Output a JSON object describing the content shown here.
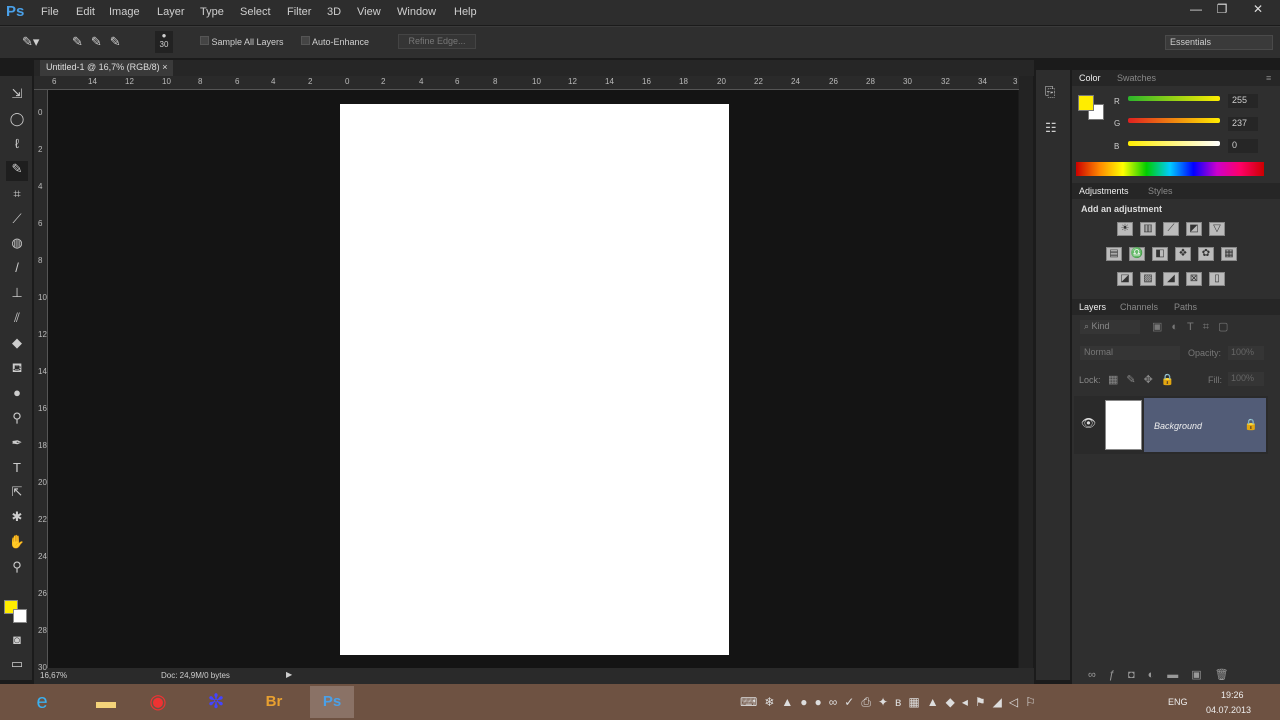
{
  "app": {
    "logo": "Ps"
  },
  "menu": [
    "File",
    "Edit",
    "Image",
    "Layer",
    "Type",
    "Select",
    "Filter",
    "3D",
    "View",
    "Window",
    "Help"
  ],
  "window_controls": {
    "minimize": "—",
    "restore": "❐",
    "close": "✕"
  },
  "options": {
    "brush_size": "30",
    "sample_all_layers": "Sample All Layers",
    "auto_enhance": "Auto-Enhance",
    "refine_edge": "Refine Edge...",
    "workspace": "Essentials"
  },
  "document_tab": {
    "title": "Untitled-1 @ 16,7% (RGB/8)",
    "close": "×"
  },
  "hruler": [
    "6",
    "14",
    "12",
    "10",
    "8",
    "6",
    "4",
    "2",
    "0",
    "2",
    "4",
    "6",
    "8",
    "10",
    "12",
    "14",
    "16",
    "18",
    "20",
    "22",
    "24",
    "26",
    "28",
    "30",
    "32",
    "34",
    "3"
  ],
  "vruler": [
    "0",
    "2",
    "4",
    "6",
    "8",
    "10",
    "12",
    "14",
    "16",
    "18",
    "20",
    "22",
    "24",
    "26",
    "28",
    "30"
  ],
  "status": {
    "zoom": "16,67%",
    "doc": "Doc: 24,9M/0 bytes"
  },
  "color_panel": {
    "tabs": [
      "Color",
      "Swatches"
    ],
    "r_label": "R",
    "g_label": "G",
    "b_label": "B",
    "r": "255",
    "g": "237",
    "b": "0",
    "foreground": "#ffed00",
    "background": "#ffffff"
  },
  "adjustments_panel": {
    "tabs": [
      "Adjustments",
      "Styles"
    ],
    "heading": "Add an adjustment"
  },
  "layers_panel": {
    "tabs": [
      "Layers",
      "Channels",
      "Paths"
    ],
    "kind": "Kind",
    "blend": "Normal",
    "opacity_label": "Opacity:",
    "opacity": "100%",
    "lock_label": "Lock:",
    "fill_label": "Fill:",
    "fill": "100%",
    "layers": [
      {
        "name": "Background",
        "visible": true,
        "locked": true
      }
    ]
  },
  "taskbar": {
    "apps": [
      "Internet Explorer",
      "File Explorer",
      "Chrome",
      "App",
      "Br",
      "Ps"
    ],
    "lang": "ENG",
    "time": "19:26",
    "date": "04.07.2013"
  }
}
